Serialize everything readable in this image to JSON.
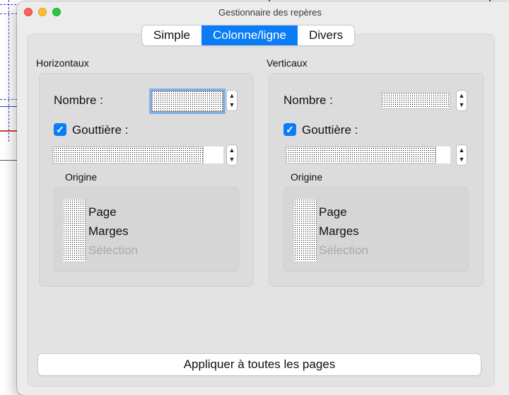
{
  "window": {
    "title": "Gestionnaire des repères"
  },
  "tabs": [
    "Simple",
    "Colonne/ligne",
    "Divers"
  ],
  "selected_tab": "Colonne/ligne",
  "horizontal": {
    "title": "Horizontaux",
    "count_label": "Nombre :",
    "gutter_label": "Gouttière :",
    "gutter_checked": true,
    "origin": {
      "title": "Origine",
      "options": [
        "Page",
        "Marges",
        "Sélection"
      ],
      "disabled_option": "Sélection"
    }
  },
  "vertical": {
    "title": "Verticaux",
    "count_label": "Nombre :",
    "gutter_label": "Gouttière :",
    "gutter_checked": true,
    "origin": {
      "title": "Origine",
      "options": [
        "Page",
        "Marges",
        "Sélection"
      ],
      "disabled_option": "Sélection"
    }
  },
  "apply_button": "Appliquer à toutes les pages",
  "colors": {
    "accent": "#0a7cf5",
    "window_bg": "#ececec",
    "guide_blue": "#3a3ad0",
    "guide_red": "#d04030"
  },
  "icons": {
    "stepper": "stepper-arrows-icon",
    "checkbox": "checkmark-icon"
  }
}
